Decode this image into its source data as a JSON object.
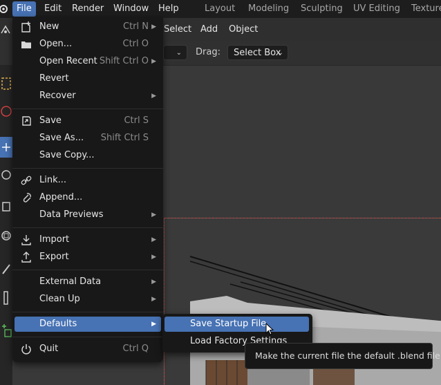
{
  "topbar": {
    "menus": [
      "File",
      "Edit",
      "Render",
      "Window",
      "Help"
    ],
    "workspaces": [
      "Layout",
      "Modeling",
      "Sculpting",
      "UV Editing",
      "Texture"
    ]
  },
  "header": {
    "view_menus": [
      "Select",
      "Add",
      "Object"
    ],
    "drag_label": "Drag:",
    "drag_value": "Select Box"
  },
  "file_menu": {
    "items": [
      {
        "label": "New",
        "shortcut": "Ctrl N",
        "icon": "new-file-icon"
      },
      {
        "label": "Open...",
        "shortcut": "Ctrl O",
        "icon": "folder-icon"
      },
      {
        "label": "Open Recent",
        "shortcut": "Shift Ctrl O",
        "icon": ""
      },
      {
        "label": "Revert",
        "shortcut": "",
        "icon": ""
      },
      {
        "label": "Recover",
        "shortcut": "",
        "icon": ""
      },
      {
        "label": "Save",
        "shortcut": "Ctrl S",
        "icon": "save-icon"
      },
      {
        "label": "Save As...",
        "shortcut": "Shift Ctrl S",
        "icon": ""
      },
      {
        "label": "Save Copy...",
        "shortcut": "",
        "icon": ""
      },
      {
        "label": "Link...",
        "shortcut": "",
        "icon": "link-icon"
      },
      {
        "label": "Append...",
        "shortcut": "",
        "icon": "append-icon"
      },
      {
        "label": "Data Previews",
        "shortcut": "",
        "icon": ""
      },
      {
        "label": "Import",
        "shortcut": "",
        "icon": "import-icon"
      },
      {
        "label": "Export",
        "shortcut": "",
        "icon": "export-icon"
      },
      {
        "label": "External Data",
        "shortcut": "",
        "icon": ""
      },
      {
        "label": "Clean Up",
        "shortcut": "",
        "icon": ""
      },
      {
        "label": "Defaults",
        "shortcut": "",
        "icon": ""
      },
      {
        "label": "Quit",
        "shortcut": "Ctrl Q",
        "icon": "power-icon"
      }
    ]
  },
  "defaults_submenu": {
    "items": [
      "Save Startup File",
      "Load Factory Settings"
    ]
  },
  "tooltip": {
    "text": "Make the current file the default .blend file."
  },
  "colors": {
    "accent": "#4772b3",
    "menu_bg": "#181818",
    "topbar_bg": "#1d1d1d"
  }
}
